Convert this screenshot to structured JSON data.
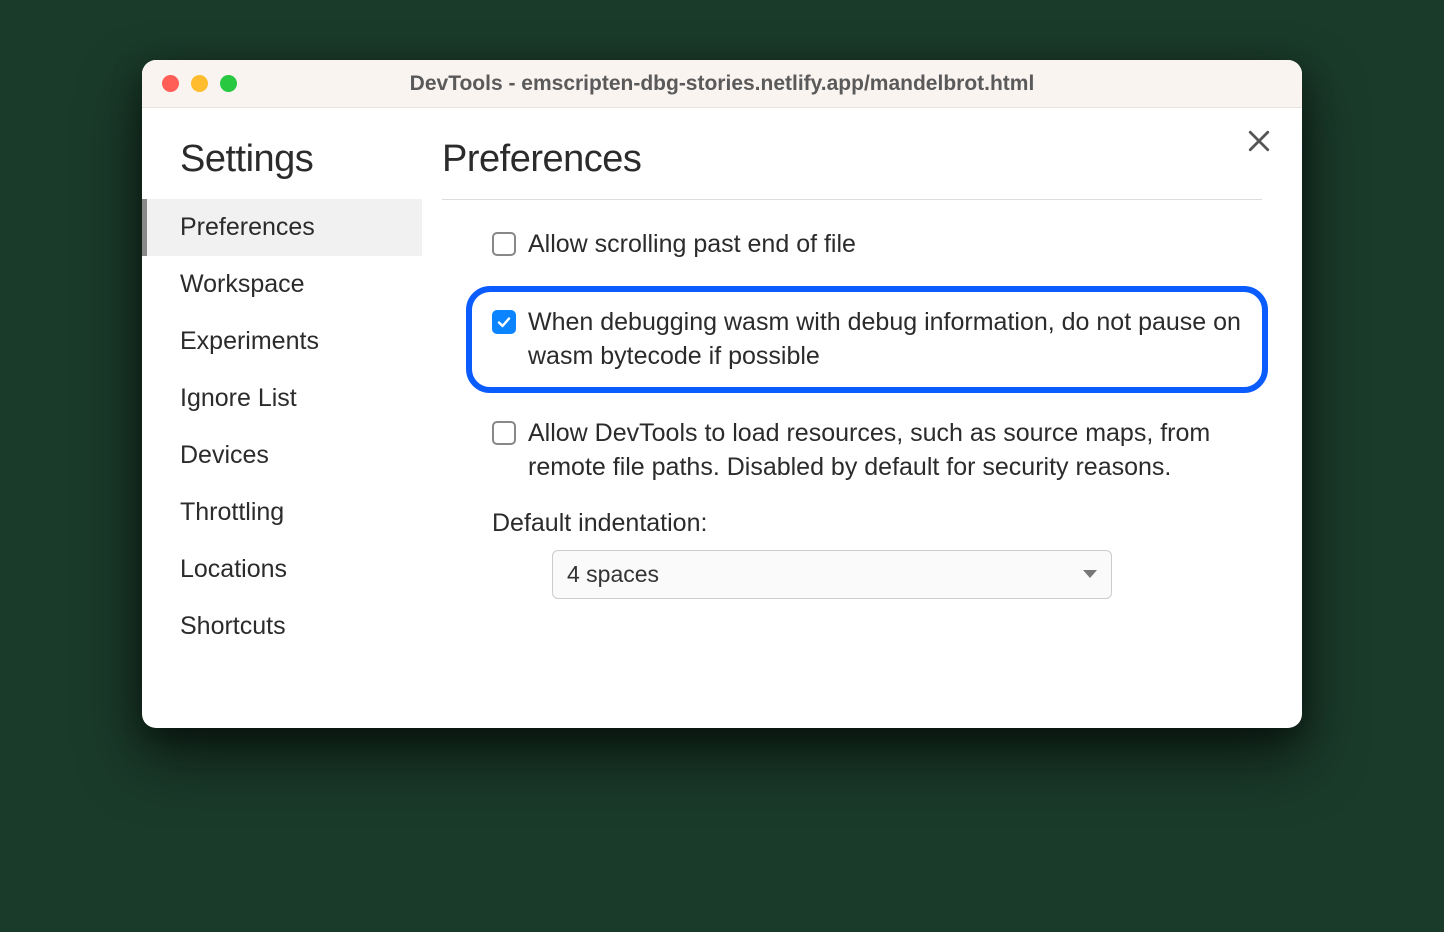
{
  "window": {
    "title": "DevTools - emscripten-dbg-stories.netlify.app/mandelbrot.html"
  },
  "sidebar": {
    "title": "Settings",
    "items": [
      {
        "label": "Preferences",
        "active": true
      },
      {
        "label": "Workspace",
        "active": false
      },
      {
        "label": "Experiments",
        "active": false
      },
      {
        "label": "Ignore List",
        "active": false
      },
      {
        "label": "Devices",
        "active": false
      },
      {
        "label": "Throttling",
        "active": false
      },
      {
        "label": "Locations",
        "active": false
      },
      {
        "label": "Shortcuts",
        "active": false
      }
    ]
  },
  "main": {
    "title": "Preferences",
    "prefs": [
      {
        "label": "Allow scrolling past end of file",
        "checked": false,
        "highlighted": false
      },
      {
        "label": "When debugging wasm with debug information, do not pause on wasm bytecode if possible",
        "checked": true,
        "highlighted": true
      },
      {
        "label": "Allow DevTools to load resources, such as source maps, from remote file paths. Disabled by default for security reasons.",
        "checked": false,
        "highlighted": false
      }
    ],
    "indentation": {
      "label": "Default indentation:",
      "value": "4 spaces"
    }
  }
}
